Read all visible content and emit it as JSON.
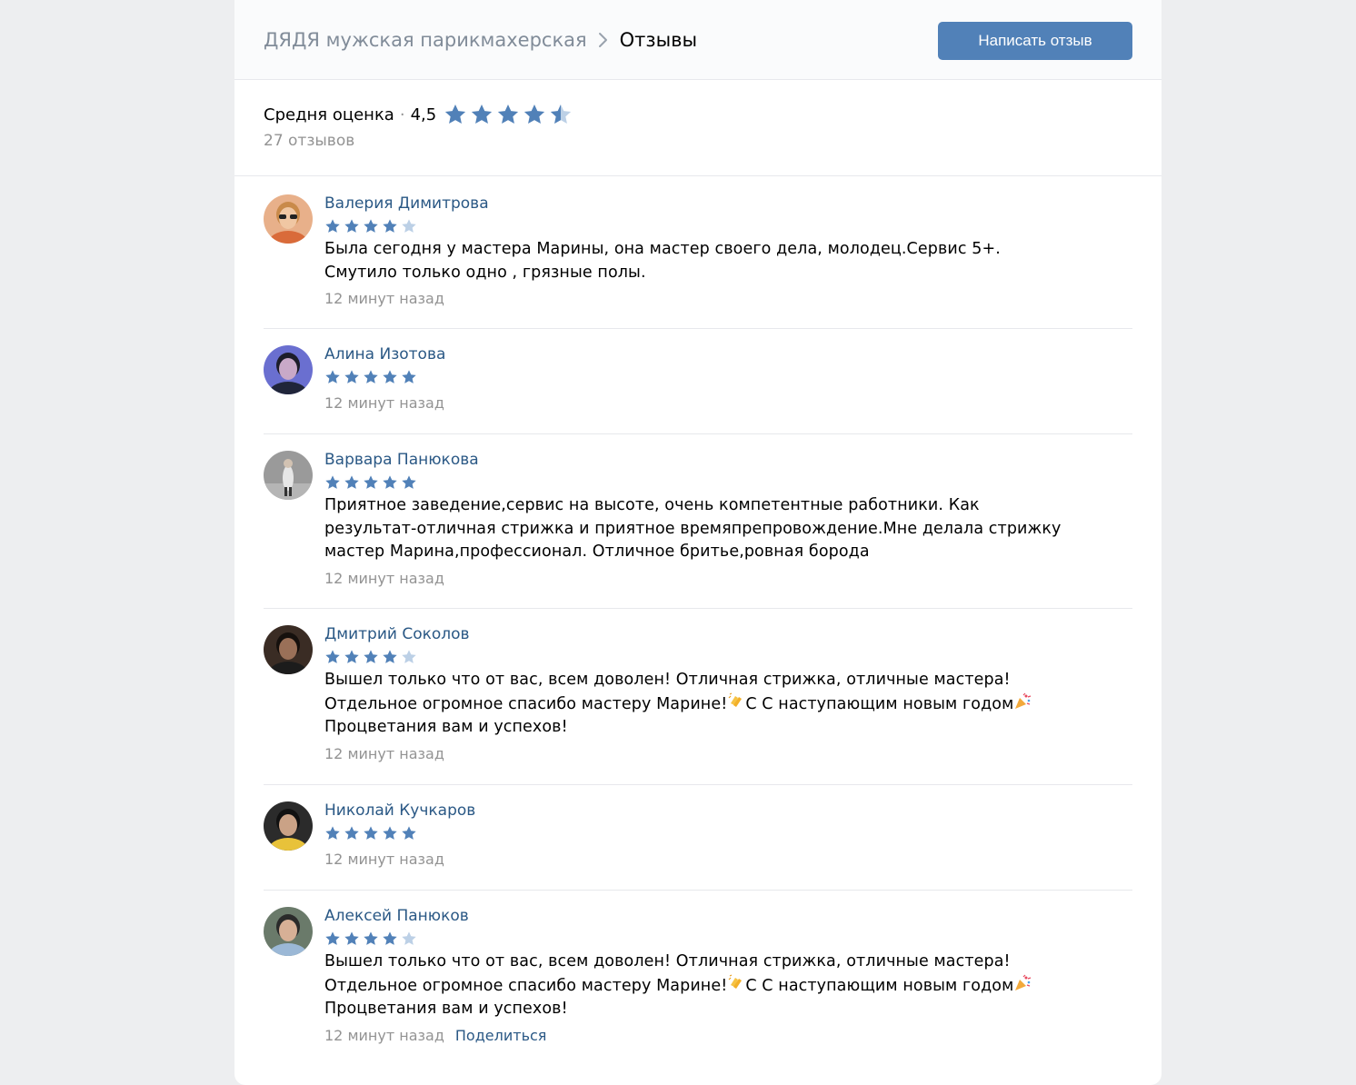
{
  "header": {
    "breadcrumb_parent": "ДЯДЯ мужская парикмахерская",
    "breadcrumb_current": "Отзывы",
    "write_review_label": "Написать отзыв"
  },
  "summary": {
    "label": "Средня оценка",
    "separator": "·",
    "rating": "4,5",
    "rating_value": 4.5,
    "count_text": "27 отзывов"
  },
  "colors": {
    "accent": "#5181b8",
    "link": "#2a5885",
    "muted": "#939393",
    "star_filled": "#5181b8",
    "star_empty": "#bcd0e6"
  },
  "reviews": [
    {
      "author": "Валерия Димитрова",
      "stars": 4,
      "text_lines": [
        "Была сегодня у мастера Марины, она мастер своего дела, молодец.Сервис 5+.",
        "Смутило только одно , грязные полы."
      ],
      "time": "12 минут назад"
    },
    {
      "author": "Алина Изотова",
      "stars": 5,
      "text_lines": [],
      "time": "12 минут назад"
    },
    {
      "author": "Варвара Панюкова",
      "stars": 5,
      "text_lines": [
        "Приятное заведение,сервис на высоте, очень компетентные работники. Как",
        "результат-отличная стрижка и приятное времяпрепровождение.Мне делала стрижку",
        "мастер Марина,профессионал. Отличное бритье,ровная борода"
      ],
      "time": "12 минут назад"
    },
    {
      "author": "Дмитрий Соколов",
      "stars": 4,
      "text_lines": [
        "Вышел только что от вас, всем доволен! Отличная стрижка, отличные мастера!",
        "Отдельное огромное спасибо мастеру Марине!",
        "С С наступающим новым годом",
        "Процветания вам и успехов!"
      ],
      "time": "12 минут назад"
    },
    {
      "author": "Николай Кучкаров",
      "stars": 5,
      "text_lines": [],
      "time": "12 минут назад"
    },
    {
      "author": "Алексей Панюков",
      "stars": 4,
      "text_lines": [
        "Вышел только что от вас, всем доволен! Отличная стрижка, отличные мастера!",
        "Отдельное огромное спасибо мастеру Марине!",
        "С С наступающим новым годом",
        "Процветания вам и успехов!"
      ],
      "time": "12 минут назад",
      "share_label": "Поделиться"
    }
  ]
}
